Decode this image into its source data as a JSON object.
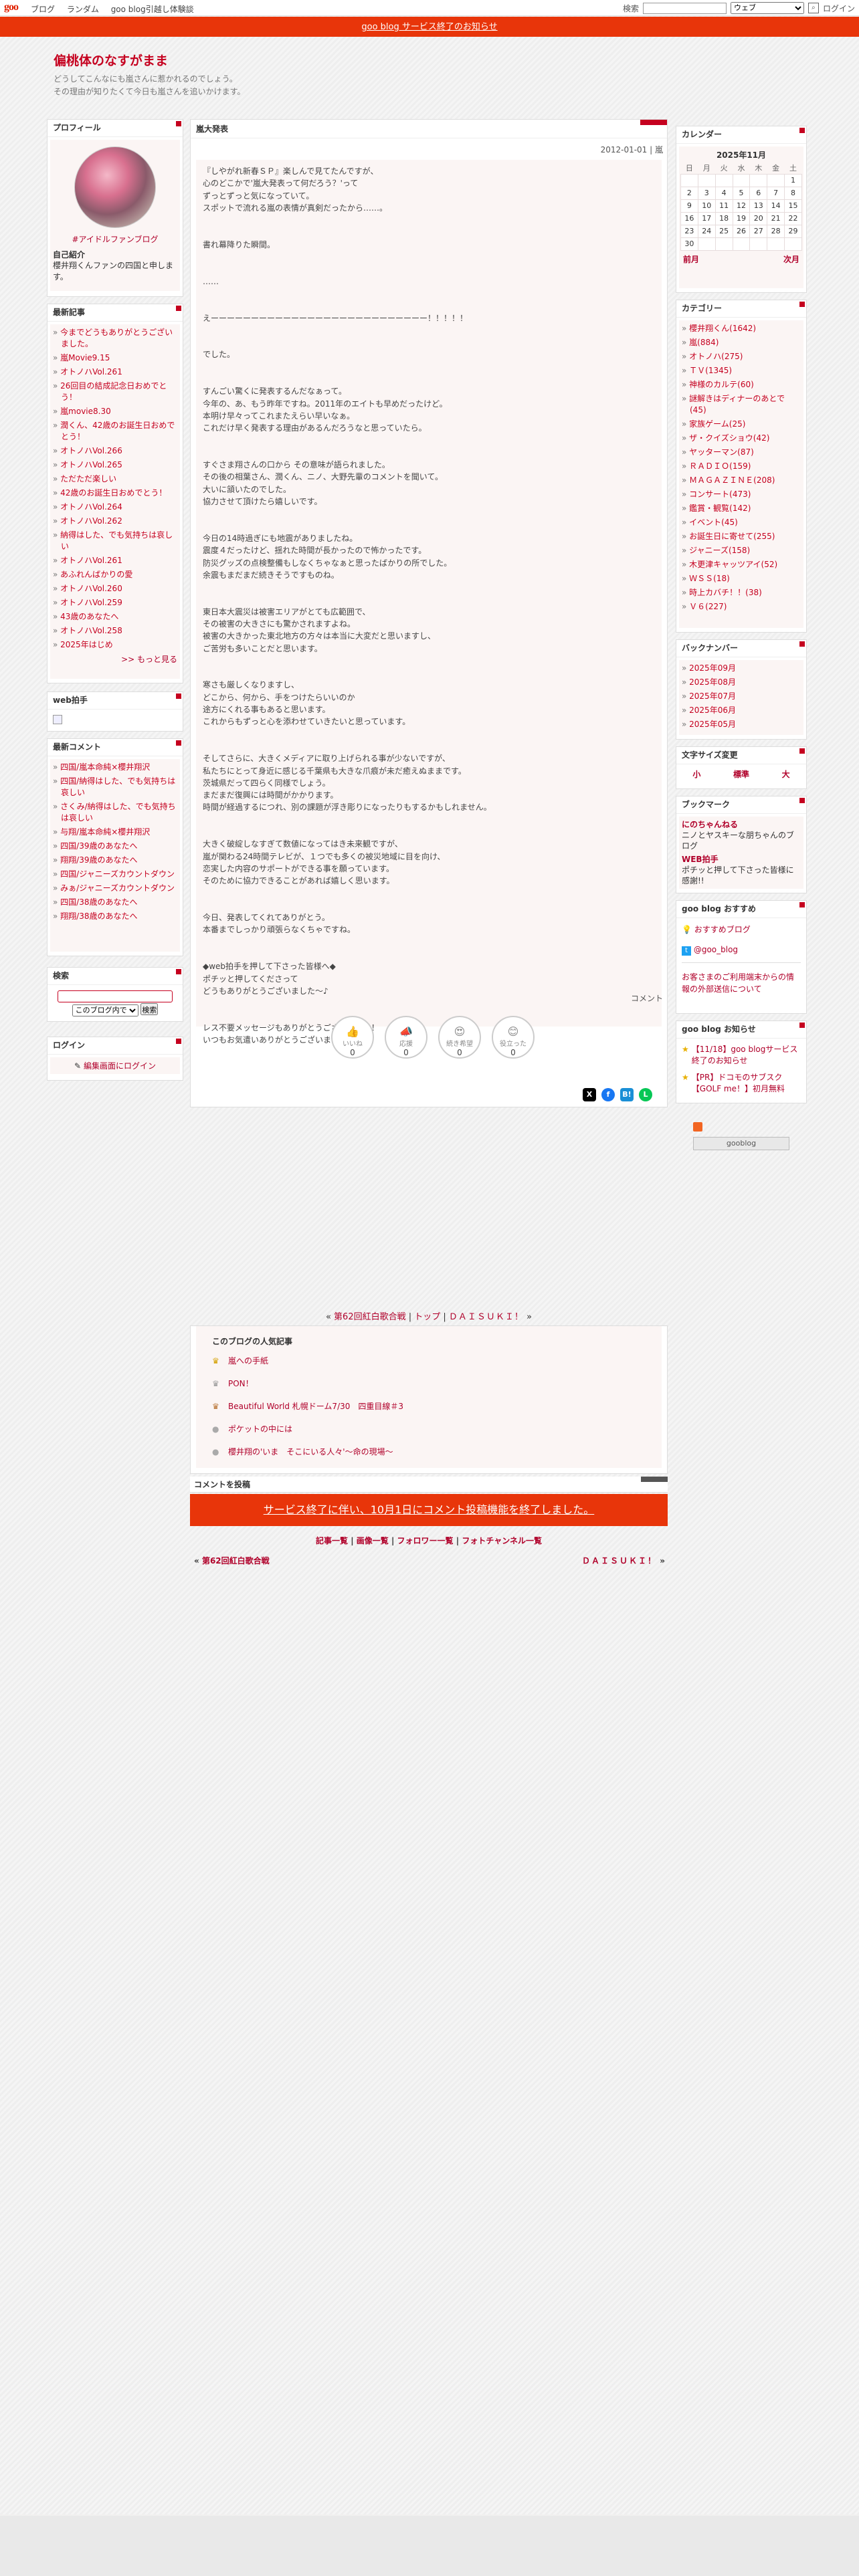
{
  "topbar": {
    "logo": "goo",
    "nav": [
      "ブログ",
      "ランダム",
      "goo blog引越し体験談"
    ],
    "search_label": "検索",
    "search_scope": "ウェブ",
    "login": "ログイン"
  },
  "notice": "goo blog サービス終了のお知らせ",
  "header": {
    "title": "偏桃体のなすがまま",
    "desc1": "どうしてこんなにも嵐さんに惹かれるのでしょう。",
    "desc2": "その理由が知りたくて今日も嵐さんを追いかけます。"
  },
  "profile": {
    "title": "プロフィール",
    "link": "#アイドルファンブログ",
    "intro_label": "自己紹介",
    "intro": "櫻井翔くんファンの四国と申します。"
  },
  "recent": {
    "title": "最新記事",
    "items": [
      "今までどうもありがとうございました。",
      "嵐Movie9.15",
      "オトノハVol.261",
      "26回目の結成記念日おめでとう！",
      "嵐movie8.30",
      "潤くん、42歳のお誕生日おめでとう！",
      "オトノハVol.266",
      "オトノハVol.265",
      "ただただ楽しい",
      "42歳のお誕生日おめでとう！",
      "オトノハVol.264",
      "オトノハVol.262",
      "納得はした、でも気持ちは哀しい",
      "オトノハVol.261",
      "あふれんばかりの愛",
      "オトノハVol.260",
      "オトノハVol.259",
      "43歳のあなたへ",
      "オトノハVol.258",
      "2025年はじめ"
    ],
    "more": ">> もっと見る"
  },
  "webclap": {
    "title": "web拍手"
  },
  "comments": {
    "title": "最新コメント",
    "items": [
      "四国/嵐本命純×櫻井翔沢",
      "四国/納得はした、でも気持ちは哀しい",
      "さくみ/納得はした、でも気持ちは哀しい",
      "与翔/嵐本命純×櫻井翔沢",
      "四国/39歳のあなたへ",
      "翔翔/39歳のあなたへ",
      "四国/ジャニーズカウントダウン",
      "みぁ/ジャニーズカウントダウン",
      "四国/38歳のあなたへ",
      "翔翔/38歳のあなたへ"
    ]
  },
  "search": {
    "title": "検索",
    "scope": "このブログ内で",
    "button": "検索"
  },
  "login": {
    "title": "ログイン",
    "link": "編集画面にログイン"
  },
  "post": {
    "category_title": "嵐大発表",
    "date": "2012-01-01 | 嵐",
    "body": "『しやがれ新春ＳＰ』楽しんで見てたんですが、\n心のどこかで'嵐大発表って何だろう？'って\nずっとずっと気になっていて。\nスポットで流れる嵐の表情が真剣だったから……。\n\n\n書れ幕降りた瞬間。\n\n\n……\n\n\nえーーーーーーーーーーーーーーーーーーーーーーーーーーー！！！！！\n\n\nでした。\n\n\nすんごい驚くに発表するんだなぁって。\n今年の、あ、もう昨年ですね。2011年のエイトも早めだったけど。\n本明け早々ってこれまたえらい早いなぁ。\nこれだけ早く発表する理由があるんだろうなと思っていたら。\n\n\nすぐさま翔さんの口から その意味が語られました。\nその後の相葉さん、潤くん、ニノ、大野先輩のコメントを聞いて。\n大いに頷いたのでした。\n協力させて頂けたら嬉しいです。\n\n\n今日の14時過ぎにも地震がありましたね。\n震度４だったけど、揺れた時間が長かったので怖かったです。\n防災グッズの点検整備もしなくちゃなぁと思ったばかりの所でした。\n余震もまだまだ続きそうですものね。\n\n\n東日本大震災は被害エリアがとても広範囲で、\nその被害の大きさにも驚かされますよね。\n被害の大きかった東北地方の方々は本当に大変だと思いますし、\nご苦労も多いことだと思います。\n\n\n寒さも厳しくなりますし、\nどこから、何から、手をつけたらいいのか\n途方にくれる事もあると思います。\nこれからもずっと心を添わせていきたいと思っています。\n\n\nそしてさらに、大きくメディアに取り上げられる事が少ないですが、\n私たちにとって身近に感じる千葉県も大きな爪痕が未だ癒えぬままです。\n茨城県だって四らく同様でしょう。\nまだまだ復興には時間がかかります。\n時間が経過するにつれ、別の課題が浮き彫りになったりもするかもしれません。\n\n\n大きく破綻しなすぎて数値になってはき未来観ですが、\n嵐が関わる24時間テレビが、１つでも多くの被災地域に目を向け、\n恋実した内容のサポートができる事を願っています。\nそのために協力できることがあれば嬉しく思います。\n\n\n今日、発表してくれてありがとう。\n本番までしっかり頑張らなくちゃですね。\n\n\n◆web拍手を押して下さった皆様へ◆\nポチッと押してくださって\nどうもありがとうございました〜♪\n\n\nレス不要メッセージもありがとうございました！\nいつもお気遣いありがとうございます(*^_^*)",
    "comment_link": "コメント",
    "reactions": [
      {
        "label": "いいね",
        "icon": "👍",
        "count": "0"
      },
      {
        "label": "応援",
        "icon": "📣",
        "count": "0"
      },
      {
        "label": "続き希望",
        "icon": "😍",
        "count": "0"
      },
      {
        "label": "役立った",
        "icon": "😊",
        "count": "0"
      }
    ],
    "sns": [
      "X",
      "f",
      "B!",
      "L"
    ]
  },
  "calendar": {
    "title": "カレンダー",
    "month": "2025年11月",
    "weekdays": [
      "日",
      "月",
      "火",
      "水",
      "木",
      "金",
      "土"
    ],
    "days": [
      "",
      "",
      "",
      "",
      "",
      "",
      "1",
      "2",
      "3",
      "4",
      "5",
      "6",
      "7",
      "8",
      "9",
      "10",
      "11",
      "12",
      "13",
      "14",
      "15",
      "16",
      "17",
      "18",
      "19",
      "20",
      "21",
      "22",
      "23",
      "24",
      "25",
      "26",
      "27",
      "28",
      "29",
      "30",
      "",
      "",
      "",
      "",
      "",
      ""
    ],
    "prev": "前月",
    "next": "次月"
  },
  "categories": {
    "title": "カテゴリー",
    "items": [
      "櫻井翔くん(1642)",
      "嵐(884)",
      "オトノハ(275)",
      "ＴＶ(1345)",
      "神様のカルテ(60)",
      "謎解きはディナーのあとで(45)",
      "家族ゲーム(25)",
      "ザ・クイズショウ(42)",
      "ヤッターマン(87)",
      "ＲＡＤＩＯ(159)",
      "ＭＡＧＡＺＩＮＥ(208)",
      "コンサート(473)",
      "鑑賞・観覧(142)",
      "イベント(45)",
      "お誕生日に寄せて(255)",
      "ジャニーズ(158)",
      "木更津キャッツアイ(52)",
      "ＷＳＳ(18)",
      "時上カバチ！！(38)",
      "Ｖ６(227)"
    ]
  },
  "backnumber": {
    "title": "バックナンバー",
    "items": [
      "2025年09月",
      "2025年08月",
      "2025年07月",
      "2025年06月",
      "2025年05月"
    ]
  },
  "fontsize": {
    "title": "文字サイズ変更",
    "small": "小",
    "mid": "標準",
    "large": "大"
  },
  "bookmark": {
    "title": "ブックマーク",
    "items": [
      {
        "name": "にのちゃんねる",
        "desc": "ニノとヤスキーな朋ちゃんのブログ"
      },
      {
        "name": "WEB拍手",
        "desc": "ポチッと押して下さった皆様に感謝!!"
      }
    ]
  },
  "recommend": {
    "title": "goo blog おすすめ",
    "link1": "おすすめブログ",
    "link2": "@goo_blog",
    "notice": "お客さまのご利用端末からの情報の外部送信について"
  },
  "gooinfo": {
    "title": "goo blog お知らせ",
    "items": [
      "【11/18】goo blogサービス終了のお知らせ",
      "【PR】ドコモのサブスク【GOLF me！】初月無料"
    ]
  },
  "goobtn": "gooblog",
  "nav2": {
    "prev": "第62回紅白歌合戦",
    "top": "トップ",
    "next": "ＤＡＩＳＵＫＩ！"
  },
  "popular": {
    "title": "このブログの人気記事",
    "items": [
      "嵐への手紙",
      "PON！",
      "Beautiful World 札幌ドーム7/30　四重目線＃3",
      "ポケットの中には",
      "櫻井翔の'いま　そこにいる人々'〜命の現場〜"
    ]
  },
  "comment_title": "コメントを投稿",
  "comment_banner": "サービス終了に伴い、10月1日にコメント投稿機能を終了しました。",
  "bottomlinks": [
    "記事一覧",
    "画像一覧",
    "フォロワー一覧",
    "フォトチャンネル一覧"
  ],
  "prevnext": {
    "prev": "第62回紅白歌合戦",
    "next": "ＤＡＩＳＵＫＩ！"
  }
}
